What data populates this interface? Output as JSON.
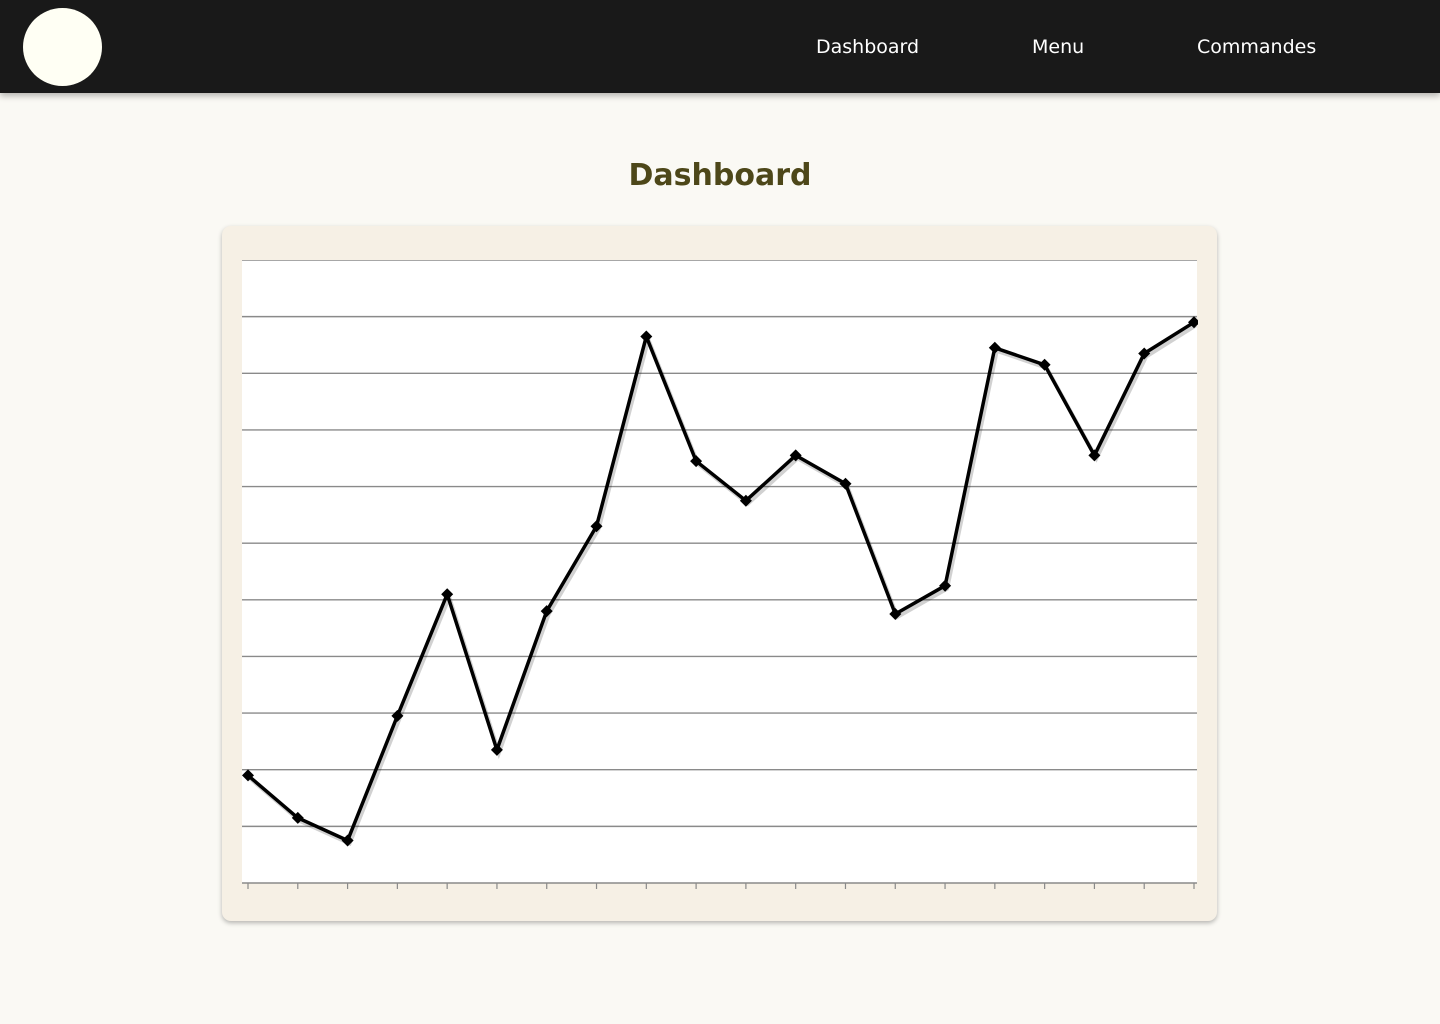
{
  "nav": {
    "links": [
      {
        "label": "Dashboard"
      },
      {
        "label": "Menu"
      },
      {
        "label": "Commandes"
      }
    ]
  },
  "page": {
    "title": "Dashboard"
  },
  "chart_data": {
    "type": "line",
    "x": [
      0,
      1,
      2,
      3,
      4,
      5,
      6,
      7,
      8,
      9,
      10,
      11,
      12,
      13,
      14,
      15,
      16,
      17,
      18,
      19
    ],
    "series": [
      {
        "values": [
          1.9,
          1.15,
          0.75,
          2.95,
          5.1,
          2.35,
          4.8,
          6.3,
          9.65,
          7.45,
          6.75,
          7.55,
          7.05,
          4.75,
          5.25,
          9.45,
          9.15,
          7.55,
          9.35,
          9.9
        ]
      }
    ],
    "ylim": [
      0,
      11
    ],
    "xlim": [
      0,
      19
    ],
    "grid": true,
    "line_color": "#000000",
    "marker": "diamond"
  }
}
